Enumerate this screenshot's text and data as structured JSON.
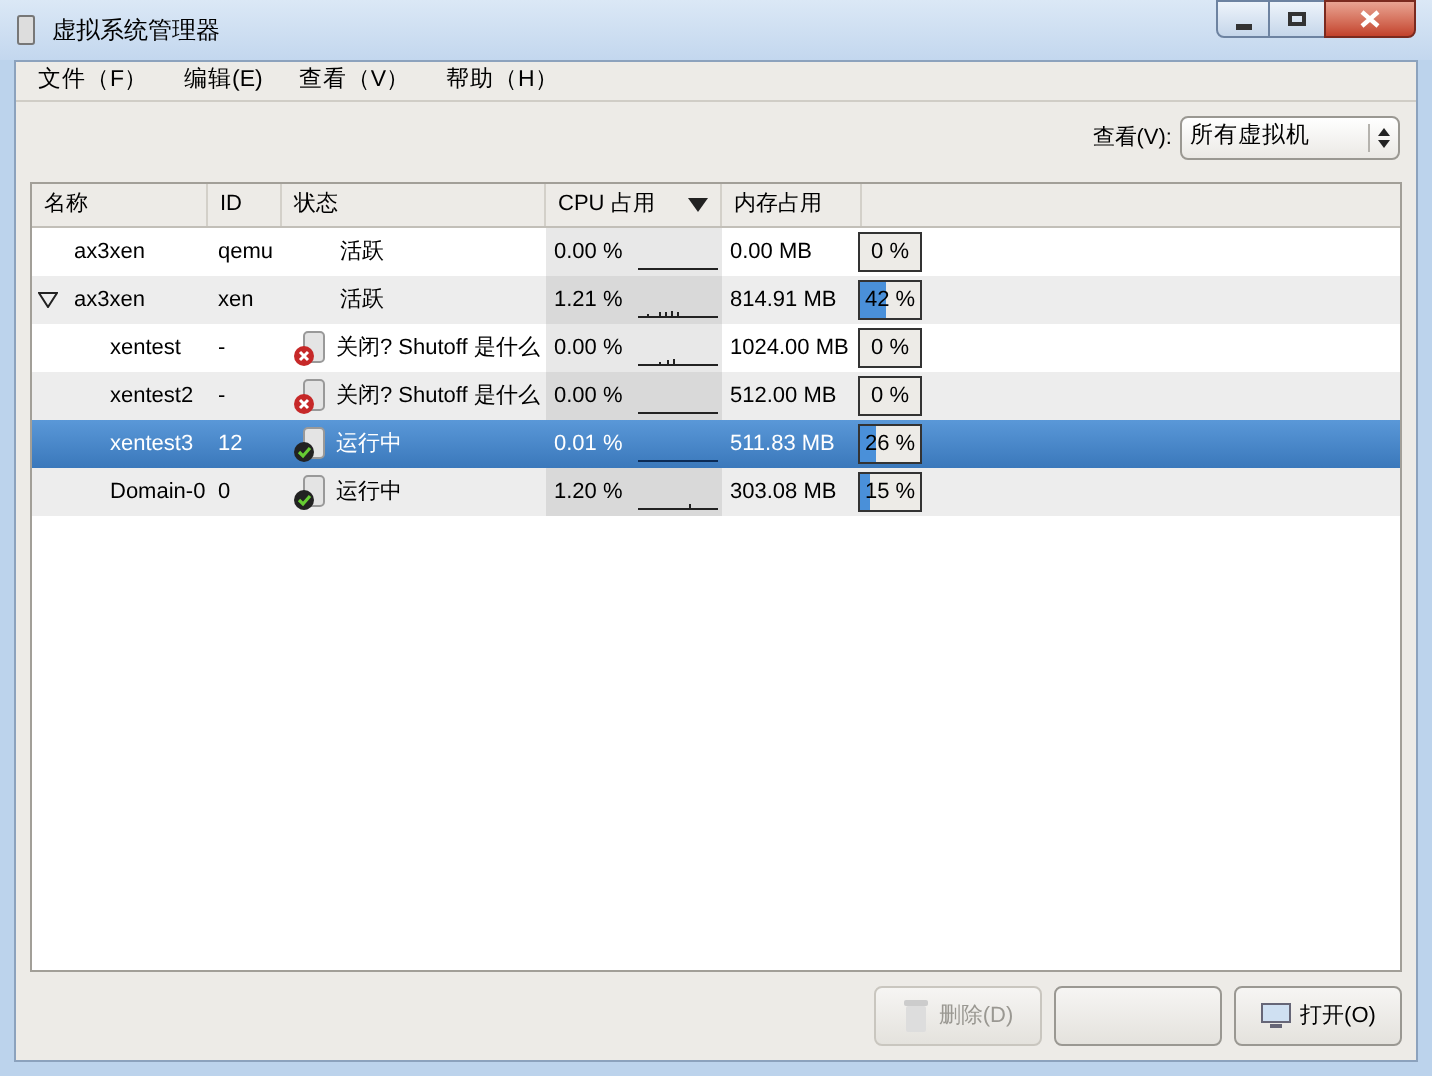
{
  "window": {
    "title": "虚拟系统管理器"
  },
  "menu": [
    "文件（F）",
    "编辑(E)",
    "查看（V）",
    "帮助（H）"
  ],
  "view_filter": {
    "label": "查看(V):",
    "value": "所有虚拟机"
  },
  "table": {
    "columns": [
      "名称",
      "ID",
      "状态",
      "CPU 占用",
      "内存占用"
    ],
    "rows": [
      {
        "name": "ax3xen",
        "id": "qemu",
        "status": "活跃",
        "kind": "connection",
        "cpu": "0.00 %",
        "memory": "0.00 MB",
        "memory_label": "0 %",
        "selected": false
      },
      {
        "name": "ax3xen",
        "id": "xen",
        "status": "活跃",
        "kind": "connection",
        "cpu": "1.21 %",
        "memory": "814.91 MB",
        "level": 0.42,
        "memory_label": "42 %",
        "selected": false,
        "expanded": true,
        "children": [
          {
            "name": "xentest",
            "id": "-",
            "status": "关闭? Shutoff 是什么",
            "kind": "shutoff",
            "cpu": "0.00 %",
            "memory": "1024.00 MB",
            "memory_label": "0 %",
            "selected": false
          },
          {
            "name": "xentest2",
            "id": "-",
            "status": "关闭? Shutoff 是什么",
            "kind": "shutoff",
            "cpu": "0.00 %",
            "memory": "512.00 MB",
            "memory_label": "0 %",
            "selected": false
          },
          {
            "name": "xentest3",
            "id": "12",
            "status": "运行中",
            "kind": "running",
            "cpu": "0.01 %",
            "memory": "511.83 MB",
            "level": 0.26,
            "memory_label": "26 %",
            "selected": true
          },
          {
            "name": "Domain-0",
            "id": "0",
            "status": "运行中",
            "kind": "running",
            "cpu": "1.20 %",
            "memory": "303.08 MB",
            "level": 0.15,
            "memory_label": "15 %",
            "selected": false
          }
        ]
      }
    ]
  },
  "buttons": [
    {
      "label": "删除(D)",
      "kind": "delete",
      "disabled": true
    },
    {
      "kind": "blank",
      "disabled": false
    },
    {
      "label": "打开(O)",
      "kind": "open",
      "disabled": false
    }
  ]
}
